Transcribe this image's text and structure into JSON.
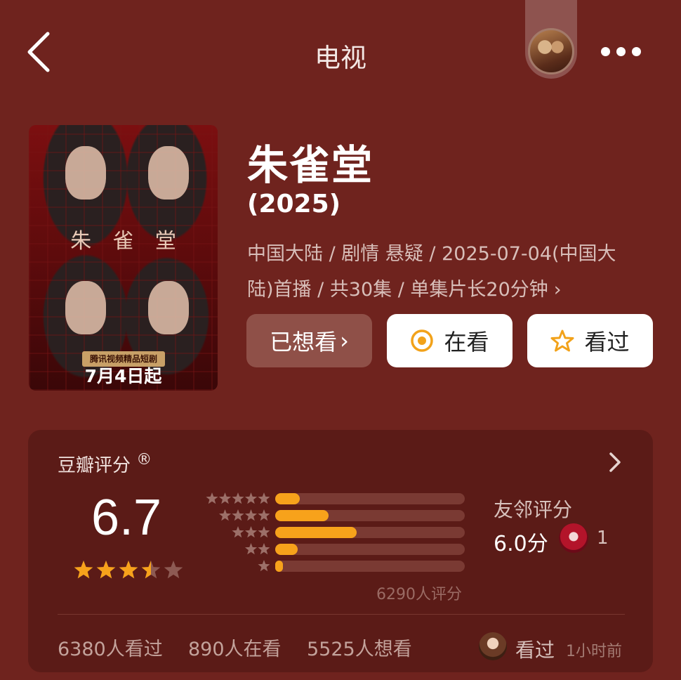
{
  "header": {
    "title": "电视",
    "back_icon": "chevron-left-icon",
    "more_icon": "more-dots-icon"
  },
  "poster": {
    "title_chars": [
      "朱",
      "雀",
      "堂"
    ],
    "tag": "腾讯视频精品短剧",
    "date": "7月4日起"
  },
  "movie": {
    "title": "朱雀堂",
    "year": "(2025)",
    "meta_line1": "中国大陆 / 剧情 悬疑 / 2025-07-04(中国大",
    "meta_line2": "陆)首播 / 共30集 / 单集片长20分钟",
    "meta_arrow": "›"
  },
  "actions": {
    "wanted": "已想看",
    "wanted_arrow": "›",
    "watching": "在看",
    "watched": "看过"
  },
  "rating": {
    "label": "豆瓣评分",
    "registered": "®",
    "score": "6.7",
    "stars_value": 3.5,
    "distribution_percent": [
      {
        "stars": 5,
        "percent": 13
      },
      {
        "stars": 4,
        "percent": 28
      },
      {
        "stars": 3,
        "percent": 43
      },
      {
        "stars": 2,
        "percent": 12
      },
      {
        "stars": 1,
        "percent": 4
      }
    ],
    "total": "6290人评分",
    "friends_label": "友邻评分",
    "friends_score": "6.0分",
    "friends_count": "1",
    "stats": [
      "6380人看过",
      "890人在看",
      "5525人想看"
    ],
    "recent_action": "看过",
    "recent_time": "1小时前"
  },
  "colors": {
    "background": "#6f231e",
    "card": "#5b1b17",
    "accent": "#f7a21b",
    "wanted_button": "#8f5048"
  }
}
